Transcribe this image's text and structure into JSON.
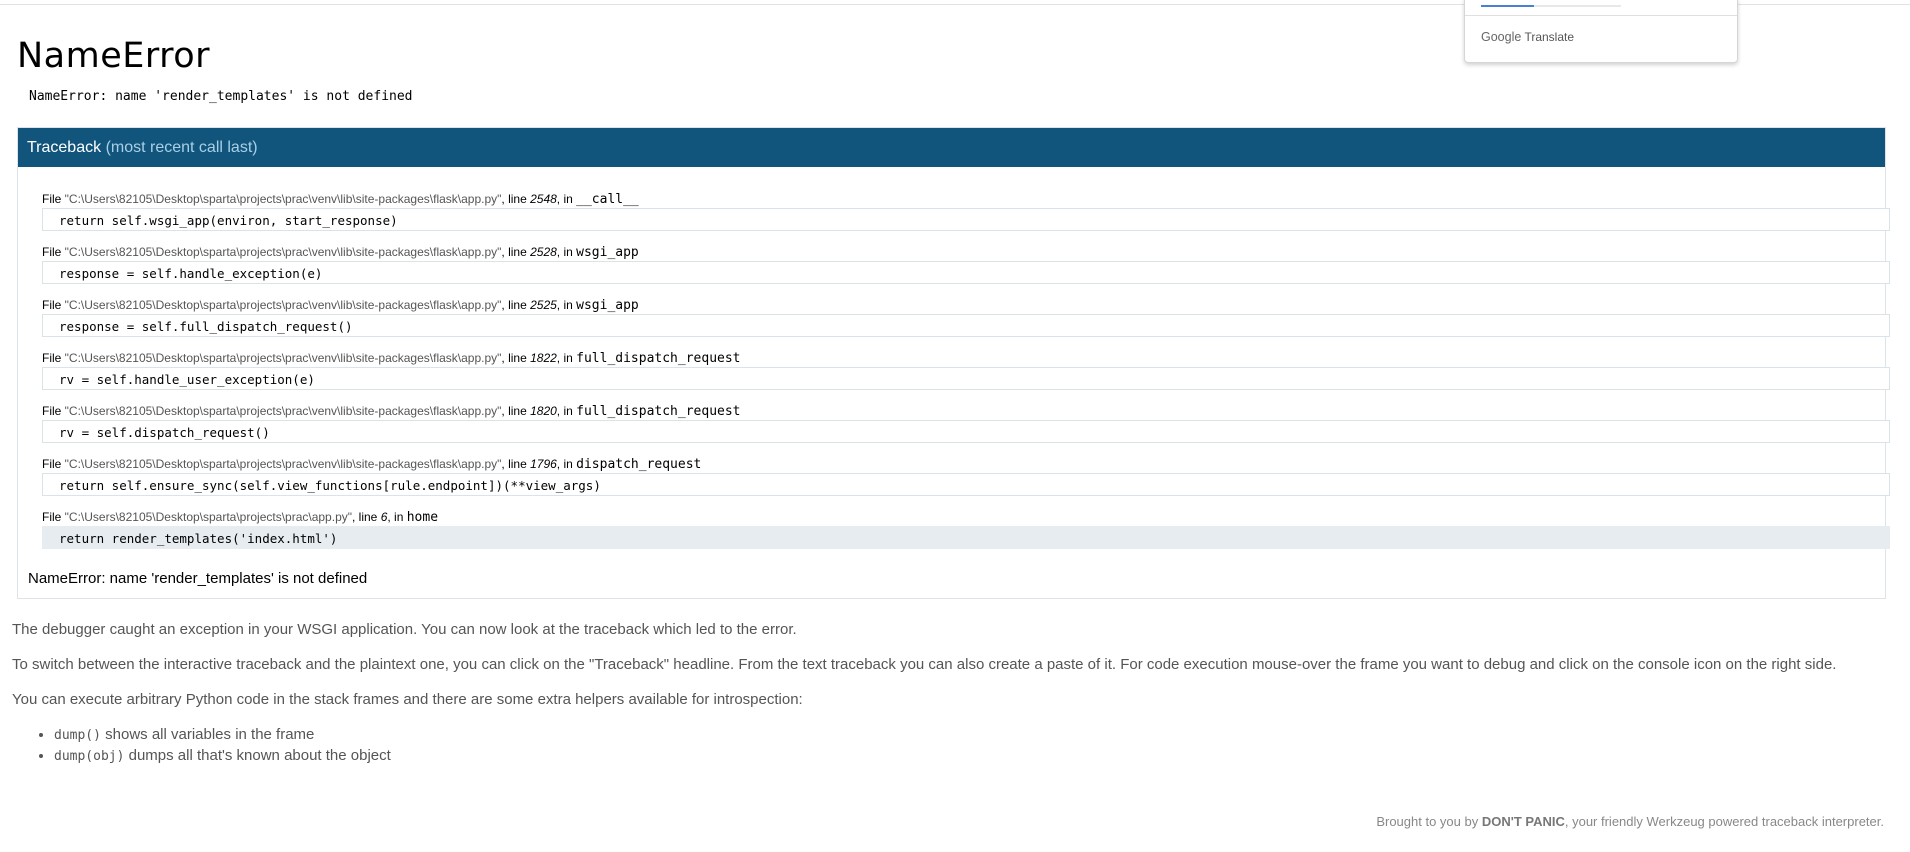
{
  "page": {
    "title": "NameError",
    "error_message": "NameError: name 'render_templates' is not defined"
  },
  "traceback": {
    "header": "Traceback",
    "header_sub": "(most recent call last)",
    "frames": [
      {
        "prefix": "File ",
        "file": "\"C:\\Users\\82105\\Desktop\\sparta\\projects\\prac\\venv\\lib\\site-packages\\flask\\app.py\"",
        "line_label": ", line ",
        "line": "2548",
        "in_label": ", in ",
        "func": "__call__",
        "code": "return self.wsgi_app(environ, start_response)"
      },
      {
        "prefix": "File ",
        "file": "\"C:\\Users\\82105\\Desktop\\sparta\\projects\\prac\\venv\\lib\\site-packages\\flask\\app.py\"",
        "line_label": ", line ",
        "line": "2528",
        "in_label": ", in ",
        "func": "wsgi_app",
        "code": "response = self.handle_exception(e)"
      },
      {
        "prefix": "File ",
        "file": "\"C:\\Users\\82105\\Desktop\\sparta\\projects\\prac\\venv\\lib\\site-packages\\flask\\app.py\"",
        "line_label": ", line ",
        "line": "2525",
        "in_label": ", in ",
        "func": "wsgi_app",
        "code": "response = self.full_dispatch_request()"
      },
      {
        "prefix": "File ",
        "file": "\"C:\\Users\\82105\\Desktop\\sparta\\projects\\prac\\venv\\lib\\site-packages\\flask\\app.py\"",
        "line_label": ", line ",
        "line": "1822",
        "in_label": ", in ",
        "func": "full_dispatch_request",
        "code": "rv = self.handle_user_exception(e)"
      },
      {
        "prefix": "File ",
        "file": "\"C:\\Users\\82105\\Desktop\\sparta\\projects\\prac\\venv\\lib\\site-packages\\flask\\app.py\"",
        "line_label": ", line ",
        "line": "1820",
        "in_label": ", in ",
        "func": "full_dispatch_request",
        "code": "rv = self.dispatch_request()"
      },
      {
        "prefix": "File ",
        "file": "\"C:\\Users\\82105\\Desktop\\sparta\\projects\\prac\\venv\\lib\\site-packages\\flask\\app.py\"",
        "line_label": ", line ",
        "line": "1796",
        "in_label": ", in ",
        "func": "dispatch_request",
        "code": "return self.ensure_sync(self.view_functions[rule.endpoint])(**view_args)"
      },
      {
        "prefix": "File ",
        "file": "\"C:\\Users\\82105\\Desktop\\sparta\\projects\\prac\\app.py\"",
        "line_label": ", line ",
        "line": "6",
        "in_label": ", in ",
        "func": "home",
        "code": "return render_templates('index.html')"
      }
    ],
    "final_error": "NameError: name 'render_templates' is not defined"
  },
  "explanation": {
    "p1": "The debugger caught an exception in your WSGI application. You can now look at the traceback which led to the error.",
    "p2": "To switch between the interactive traceback and the plaintext one, you can click on the \"Traceback\" headline. From the text traceback you can also create a paste of it. For code execution mouse-over the frame you want to debug and click on the console icon on the right side.",
    "p3": "You can execute arbitrary Python code in the stack frames and there are some extra helpers available for introspection:",
    "helpers": [
      {
        "code": "dump()",
        "text": " shows all variables in the frame"
      },
      {
        "code": "dump(obj)",
        "text": " dumps all that's known about the object"
      }
    ]
  },
  "footer": {
    "prefix": "Brought to you by ",
    "brand": "DON'T PANIC",
    "suffix": ", your friendly Werkzeug powered traceback interpreter."
  },
  "google_translate": {
    "brand": "Google",
    "label": "Translate",
    "progress": 0.38
  }
}
